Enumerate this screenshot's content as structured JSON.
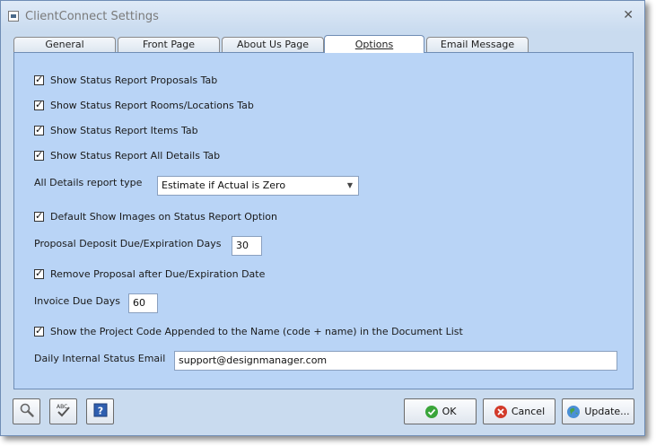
{
  "window": {
    "title": "ClientConnect Settings",
    "close_glyph": "✕"
  },
  "tabs": [
    {
      "label": "General"
    },
    {
      "label": "Front Page"
    },
    {
      "label": "About Us Page"
    },
    {
      "label": "Options",
      "active": true
    },
    {
      "label": "Email Message"
    }
  ],
  "options": {
    "show_proposals_tab": {
      "label": "Show Status Report Proposals Tab",
      "checked": true
    },
    "show_rooms_tab": {
      "label": "Show Status Report Rooms/Locations Tab",
      "checked": true
    },
    "show_items_tab": {
      "label": "Show Status Report Items Tab",
      "checked": true
    },
    "show_all_details_tab": {
      "label": "Show Status Report All Details Tab",
      "checked": true
    },
    "all_details_type": {
      "label": "All Details report type",
      "value": "Estimate if Actual is Zero"
    },
    "default_show_images": {
      "label": "Default Show Images on Status Report Option",
      "checked": true
    },
    "deposit_due_days": {
      "label": "Proposal Deposit Due/Expiration Days",
      "value": "30"
    },
    "remove_proposal": {
      "label": "Remove Proposal after Due/Expiration Date",
      "checked": true
    },
    "invoice_due_days": {
      "label": "Invoice Due Days",
      "value": "60"
    },
    "show_project_code": {
      "label": "Show the Project Code Appended to the Name (code + name) in the Document List",
      "checked": true
    },
    "daily_status_email": {
      "label": "Daily Internal Status Email",
      "value": "support@designmanager.com"
    }
  },
  "footer": {
    "tools": [
      "magnifier-icon",
      "spellcheck-icon",
      "help-icon"
    ],
    "ok_label": "OK",
    "cancel_label": "Cancel",
    "update_label": "Update..."
  }
}
